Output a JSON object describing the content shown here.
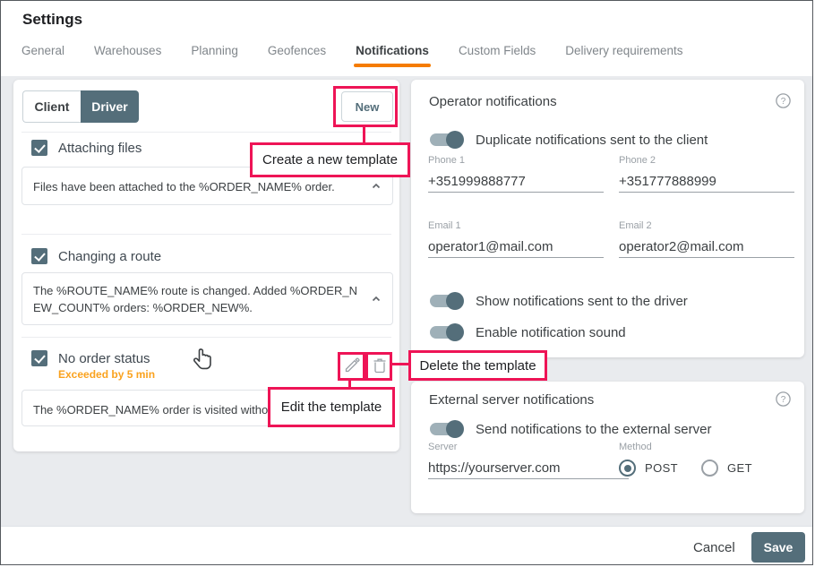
{
  "window": {
    "title": "Settings"
  },
  "tabs": [
    "General",
    "Warehouses",
    "Planning",
    "Geofences",
    "Notifications",
    "Custom Fields",
    "Delivery requirements"
  ],
  "left_panel": {
    "audience_toggle": {
      "client": "Client",
      "driver": "Driver",
      "selected": "Driver"
    },
    "new_button": "New",
    "templates": [
      {
        "label": "Attaching files",
        "checked": true,
        "text": "Files have been attached to the %ORDER_NAME% order."
      },
      {
        "label": "Changing a route",
        "checked": true,
        "text": "The %ROUTE_NAME% route is changed. Added %ORDER_NEW_COUNT% orders: %ORDER_NEW%."
      },
      {
        "label": "No order status",
        "checked": true,
        "sublabel": "Exceeded by 5 min",
        "text": "The %ORDER_NAME% order is visited without"
      }
    ]
  },
  "annotations": {
    "create": "Create a new template",
    "edit": "Edit the template",
    "delete": "Delete the template"
  },
  "operator_notifications": {
    "title": "Operator notifications",
    "toggles": [
      {
        "label": "Duplicate notifications sent to the client",
        "on": true
      },
      {
        "label": "Show notifications sent to the driver",
        "on": true
      },
      {
        "label": "Enable notification sound",
        "on": true
      }
    ],
    "fields": [
      {
        "label": "Phone 1",
        "value": "+351999888777"
      },
      {
        "label": "Phone 2",
        "value": "+351777888999"
      },
      {
        "label": "Email 1",
        "value": "operator1@mail.com"
      },
      {
        "label": "Email 2",
        "value": "operator2@mail.com"
      }
    ]
  },
  "external_server": {
    "title": "External server notifications",
    "toggle": {
      "label": "Send notifications to the external server",
      "on": true
    },
    "server": {
      "label": "Server",
      "value": "https://yourserver.com"
    },
    "method": {
      "label": "Method",
      "options": [
        {
          "label": "POST",
          "selected": true
        },
        {
          "label": "GET",
          "selected": false
        }
      ]
    }
  },
  "footer": {
    "cancel": "Cancel",
    "save": "Save"
  },
  "colors": {
    "accent": "#546e7a",
    "annotation": "#ee1456",
    "tab_underline": "#f57c00",
    "warning_text": "#faa21e",
    "content_background": "#e9ebee"
  }
}
